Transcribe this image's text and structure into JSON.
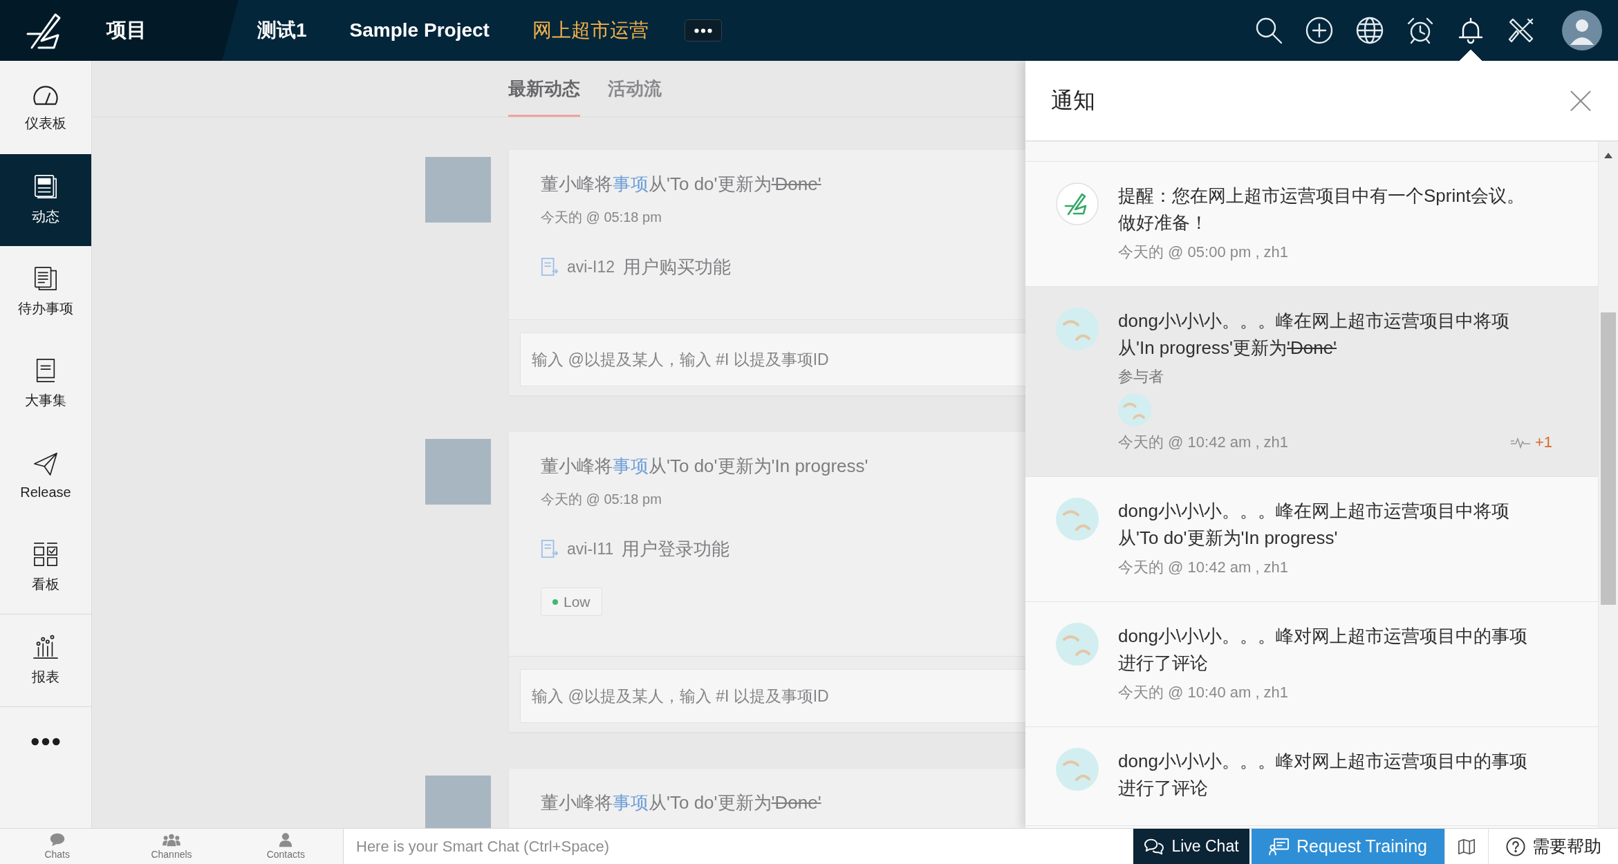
{
  "top_bar": {
    "section": "项目",
    "breadcrumbs": [
      {
        "label": "测试1",
        "selected": false
      },
      {
        "label": "Sample Project",
        "selected": false
      },
      {
        "label": "网上超市运营",
        "selected": true
      }
    ],
    "tools": [
      {
        "kind": "search",
        "selected": false
      },
      {
        "kind": "add",
        "selected": false
      },
      {
        "kind": "globe",
        "selected": false
      },
      {
        "kind": "alarm",
        "selected": false
      },
      {
        "kind": "bell",
        "selected": true
      },
      {
        "kind": "tools",
        "selected": false
      }
    ]
  },
  "sidebar": {
    "items": [
      {
        "kind": "dashboard",
        "label": "仪表板",
        "selected": false,
        "divider_before": false
      },
      {
        "kind": "feed",
        "label": "动态",
        "selected": true,
        "divider_before": false
      },
      {
        "kind": "todo",
        "label": "待办事项",
        "selected": false,
        "divider_before": false
      },
      {
        "kind": "milestones",
        "label": "大事集",
        "selected": false,
        "divider_before": false
      },
      {
        "kind": "release",
        "label": "Release",
        "selected": false,
        "divider_before": false
      },
      {
        "kind": "board",
        "label": "看板",
        "selected": false,
        "divider_before": false
      },
      {
        "kind": "reports",
        "label": "报表",
        "selected": false,
        "divider_before": true
      }
    ]
  },
  "feed": {
    "tabs": [
      {
        "label": "最新动态",
        "selected": true
      },
      {
        "label": "活动流",
        "selected": false
      }
    ],
    "posts": [
      {
        "parts": [
          {
            "kind": "text",
            "text": "董小峰将"
          },
          {
            "kind": "link",
            "text": "事项"
          },
          {
            "kind": "text",
            "text": "从'To do'更新为"
          },
          {
            "kind": "struck",
            "text": "'Done'"
          }
        ],
        "time": "今天的 @ 05:18 pm",
        "item": {
          "key": "avi-I12",
          "title": "用户购买功能"
        },
        "comment": {
          "placeholder": "输入 @以提及某人，输入 #I 以提及事项ID"
        }
      },
      {
        "parts": [
          {
            "kind": "text",
            "text": "董小峰将"
          },
          {
            "kind": "link",
            "text": "事项"
          },
          {
            "kind": "text",
            "text": "从'To do'更新为'In progress'"
          }
        ],
        "time": "今天的 @ 05:18 pm",
        "item": {
          "key": "avi-I11",
          "title": "用户登录功能"
        },
        "priority": {
          "label": "Low",
          "color": "#3dba6f"
        },
        "comment": {
          "placeholder": "输入 @以提及某人，输入 #I 以提及事项ID"
        }
      },
      {
        "parts": [
          {
            "kind": "text",
            "text": "董小峰将"
          },
          {
            "kind": "link",
            "text": "事项"
          },
          {
            "kind": "text",
            "text": "从'To do'更新为"
          },
          {
            "kind": "struck",
            "text": "'Done'"
          }
        ]
      }
    ]
  },
  "notifications": {
    "title": "通知",
    "items": [
      {
        "kind": "reminder",
        "highlighted": false,
        "parts": [
          {
            "kind": "text",
            "text": "提醒：您在网上超市运营项目中有一个Sprint会议。做好准备！"
          }
        ],
        "time": "今天的 @ 05:00 pm , zh1"
      },
      {
        "kind": "user",
        "highlighted": true,
        "parts": [
          {
            "kind": "text",
            "text": "dong小\\小\\小。。。峰在网上超市运营项目中将项从'In progress'更新为"
          },
          {
            "kind": "struck",
            "text": "'Done'"
          }
        ],
        "participants": {
          "label": "参与者"
        },
        "time": "今天的 @ 10:42 am , zh1",
        "activity": "+1"
      },
      {
        "kind": "user",
        "highlighted": false,
        "parts": [
          {
            "kind": "text",
            "text": "dong小\\小\\小。。。峰在网上超市运营项目中将项从'To do'更新为'In progress'"
          }
        ],
        "time": "今天的 @ 10:42 am , zh1"
      },
      {
        "kind": "user",
        "highlighted": false,
        "parts": [
          {
            "kind": "text",
            "text": "dong小\\小\\小。。。峰对网上超市运营项目中的事项进行了评论"
          }
        ],
        "time": "今天的 @ 10:40 am , zh1"
      },
      {
        "kind": "user",
        "highlighted": false,
        "parts": [
          {
            "kind": "text",
            "text": "dong小\\小\\小。。。峰对网上超市运营项目中的事项进行了评论"
          }
        ]
      }
    ]
  },
  "bottom_bar": {
    "chat_tabs": [
      {
        "kind": "chats",
        "label": "Chats"
      },
      {
        "kind": "channels",
        "label": "Channels"
      },
      {
        "kind": "contacts",
        "label": "Contacts"
      }
    ],
    "smart_chat": {
      "placeholder": "Here is your Smart Chat (Ctrl+Space)"
    },
    "actions": [
      {
        "kind": "live_chat",
        "label": "Live Chat"
      },
      {
        "kind": "training",
        "label": "Request Training"
      },
      {
        "kind": "guide"
      },
      {
        "kind": "help",
        "label": "需要帮助"
      }
    ]
  }
}
